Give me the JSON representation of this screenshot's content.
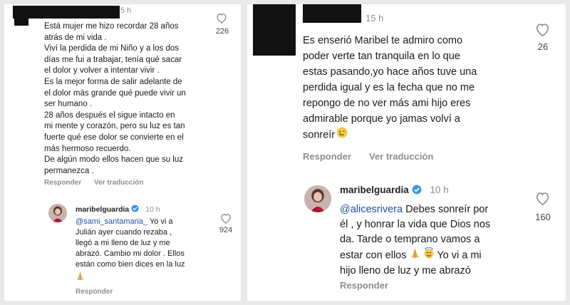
{
  "left": {
    "comment": {
      "time": "5 h",
      "text": "Está mujer me hizo recordar 28 años\natrás de mi vida .\nViví la perdida de mi Niño y a los dos\ndías me fui a trabajar, tenía qué sacar\nel dolor y volver a intentar vivir .\nEs la mejor forma de salir adelante de\nel dolor más grande qué puede vivir un\nser humano .\n28 años después el sigue intacto en\nmi mente y corazón, pero su luz es tan\nfuerte qué ese dolor se convierte en el\nmás hermoso recuerdo.\nDe algún modo ellos hacen que su luz\npermanezca .",
      "likes": "226",
      "reply_label": "Responder",
      "translate_label": "Ver traducción"
    },
    "reply": {
      "username": "maribelguardia",
      "time": "10 h",
      "mention": "@sami_santamaria_",
      "text_after_mention": "  Yo vi a\nJulián ayer cuando rezaba ,\nllegó a mi lleno de luz y me\nabrazó. Cambio mi dolor . Ellos\nestán como bien dices en la luz",
      "likes": "924",
      "reply_label": "Responder"
    }
  },
  "right": {
    "comment": {
      "time": "15 h",
      "text": "Es enserió Maribel te admiro como\npoder verte tan tranquila en lo que\nestas pasando,yo hace años tuve una\nperdida igual y es la fecha que no me\nrepongo de no ver más ami hijo eres\nadmirable porque yo jamas volví a\nsonreír",
      "likes": "26",
      "reply_label": "Responder",
      "translate_label": "Ver traducción"
    },
    "reply": {
      "username": "maribelguardia",
      "time": "10 h",
      "mention": "@alicesrivera",
      "text_after_mention": " Debes sonreír por\nél , y honrar la vida que Dios nos\nda. Tarde o temprano vamos a\nestar con ellos",
      "text_end": " Yo vi a mi\nhijo lleno de luz y me abrazó",
      "likes": "160",
      "reply_label": "Responder"
    }
  },
  "icons": {
    "like": "heart-outline-icon",
    "verified": "verified-badge-icon",
    "pray": "folded-hands-emoji",
    "halo": "smiling-face-with-halo-emoji",
    "cry": "crying-face-emoji"
  },
  "colors": {
    "mention": "#1f4fa8",
    "verified": "#3897f0",
    "meta": "#8e8e8e"
  }
}
